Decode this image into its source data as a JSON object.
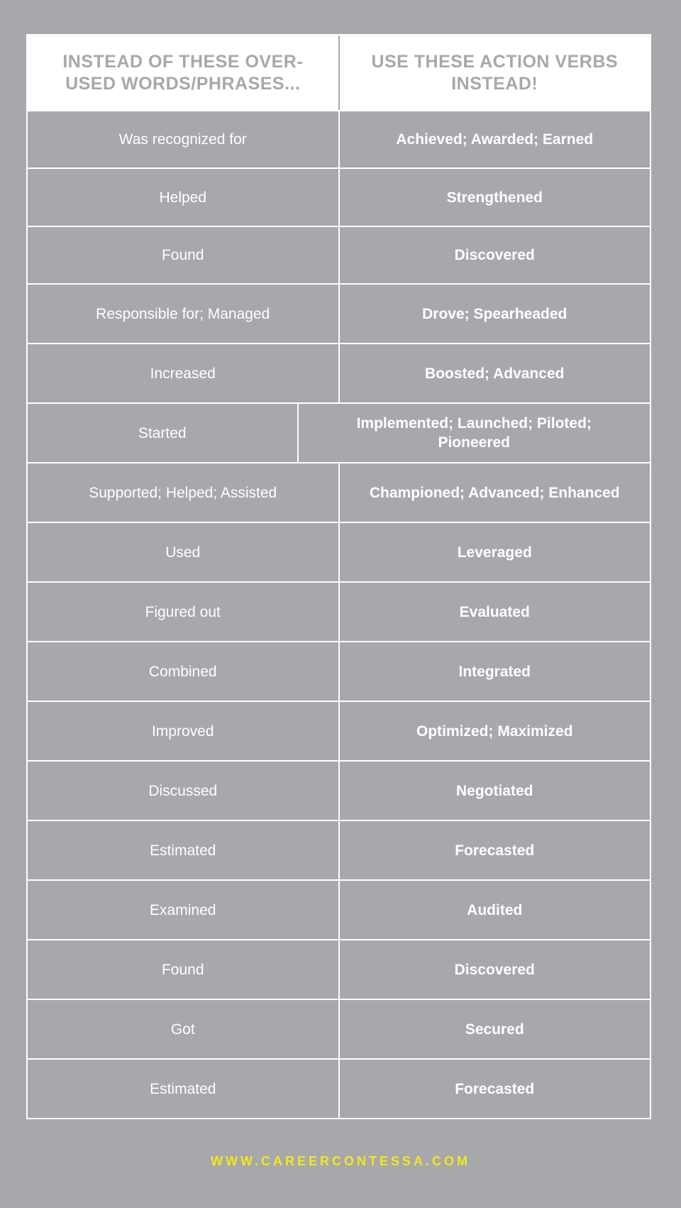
{
  "header": {
    "left": "Instead of these over-used words/phrases...",
    "right": "Use these action verbs instead!"
  },
  "rows": [
    {
      "overused": "Was recognized for",
      "action": "Achieved; Awarded; Earned"
    },
    {
      "overused": "Helped",
      "action": "Strengthened"
    },
    {
      "overused": "Found",
      "action": "Discovered"
    },
    {
      "overused": "Responsible for; Managed",
      "action": "Drove; Spearheaded"
    },
    {
      "overused": "Increased",
      "action": "Boosted; Advanced"
    },
    {
      "overused": "Started",
      "action": "Implemented; Launched; Piloted; Pioneered"
    },
    {
      "overused": "Supported; Helped; Assisted",
      "action": "Championed; Advanced; Enhanced"
    },
    {
      "overused": "Used",
      "action": "Leveraged"
    },
    {
      "overused": "Figured out",
      "action": "Evaluated"
    },
    {
      "overused": "Combined",
      "action": "Integrated"
    },
    {
      "overused": "Improved",
      "action": "Optimized; Maximized"
    },
    {
      "overused": "Discussed",
      "action": "Negotiated"
    },
    {
      "overused": "Estimated",
      "action": "Forecasted"
    },
    {
      "overused": "Examined",
      "action": "Audited"
    },
    {
      "overused": "Found",
      "action": "Discovered"
    },
    {
      "overused": "Got",
      "action": "Secured"
    },
    {
      "overused": "Estimated",
      "action": "Forecasted"
    }
  ],
  "footer": {
    "url": "WWW.CAREERCONTESSA.COM"
  },
  "colors": {
    "background": "#a7a8ac",
    "accent": "#f2e91a",
    "header_bg": "#ffffff"
  }
}
